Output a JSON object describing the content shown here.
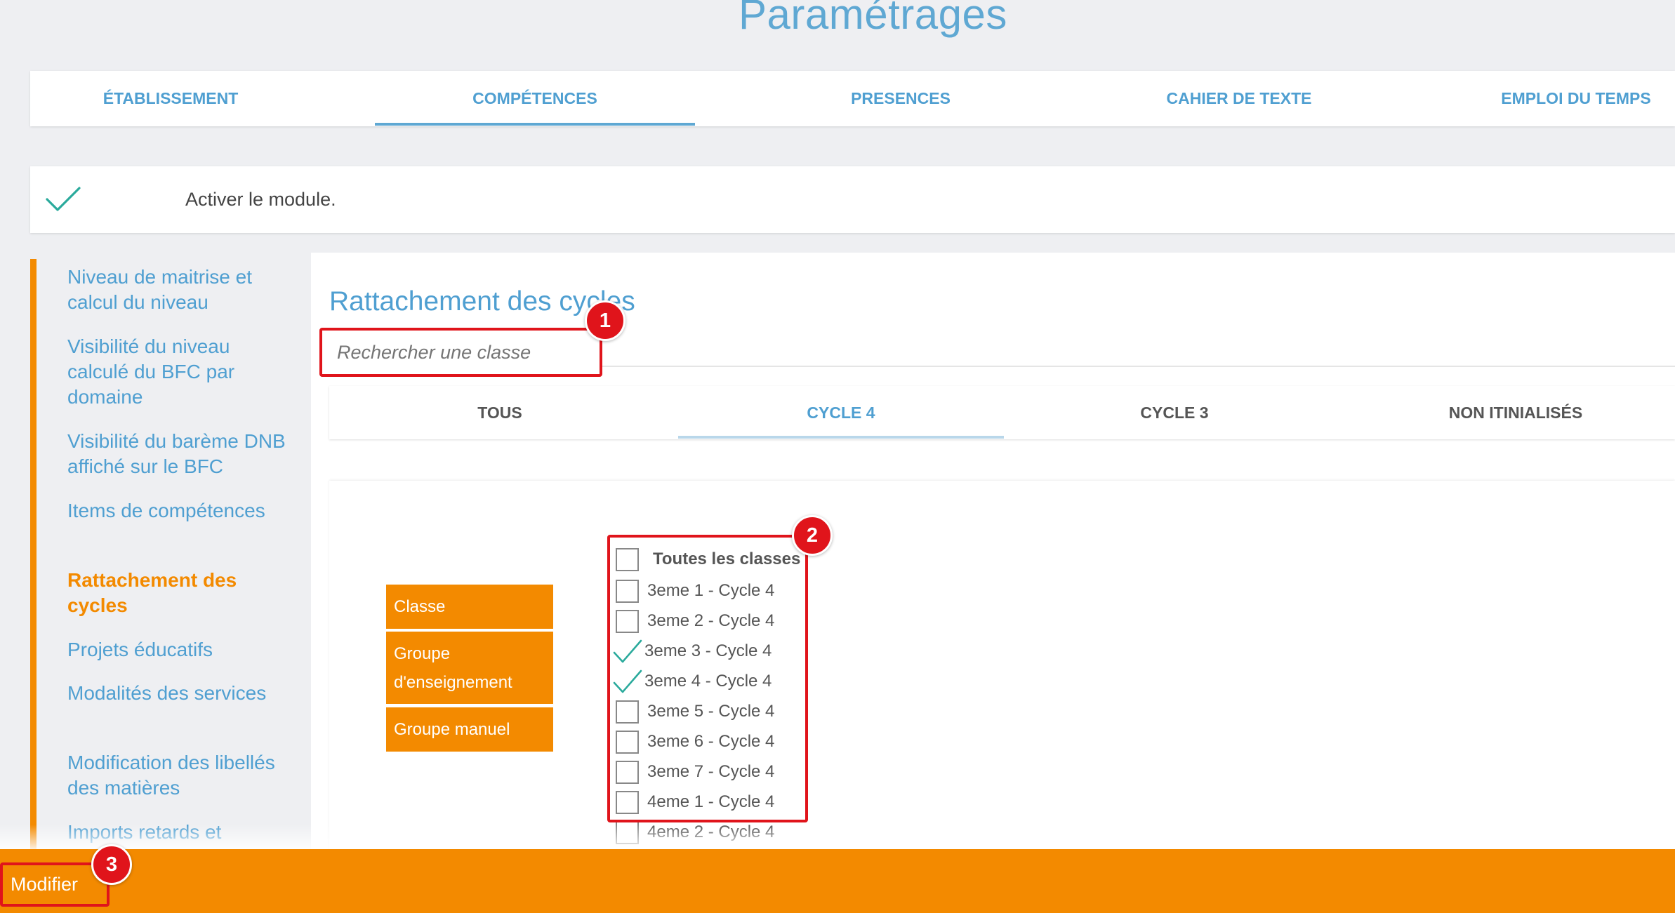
{
  "page": {
    "title": "Paramétrages"
  },
  "top_tabs": [
    {
      "label": "ÉTABLISSEMENT"
    },
    {
      "label": "COMPÉTENCES"
    },
    {
      "label": "PRESENCES"
    },
    {
      "label": "CAHIER DE TEXTE"
    },
    {
      "label": "EMPLOI DU TEMPS"
    }
  ],
  "active_top_tab": "COMPÉTENCES",
  "module": {
    "label": "Activer le module.",
    "enabled": true
  },
  "sidebar": {
    "items": [
      {
        "label": "Niveau de maitrise et calcul du niveau"
      },
      {
        "label": "Visibilité du niveau calculé du BFC par domaine"
      },
      {
        "label": "Visibilité du barème DNB affiché sur le BFC"
      },
      {
        "label": "Items de compétences"
      },
      {
        "label": "Rattachement des cycles"
      },
      {
        "label": "Projets éducatifs"
      },
      {
        "label": "Modalités des services"
      },
      {
        "label": "Modification des libellés des matières"
      },
      {
        "label": "Imports retards et"
      }
    ],
    "active_item": "Rattachement des cycles"
  },
  "main": {
    "section_title": "Rattachement des cycles",
    "search": {
      "placeholder": "Rechercher une classe",
      "value": ""
    },
    "cycle_tabs": [
      {
        "label": "TOUS"
      },
      {
        "label": "CYCLE 4"
      },
      {
        "label": "CYCLE 3"
      },
      {
        "label": "NON ITINIALISÉS"
      }
    ],
    "active_cycle_tab": "CYCLE 4",
    "group_buttons": [
      {
        "label": "Classe"
      },
      {
        "label": "Groupe d'enseignement"
      },
      {
        "label": "Groupe manuel"
      }
    ],
    "select_all": {
      "label": "Toutes les classes",
      "checked": false
    },
    "classes": [
      {
        "label": "3eme 1 - Cycle 4",
        "checked": false
      },
      {
        "label": "3eme 2 - Cycle 4",
        "checked": false
      },
      {
        "label": "3eme 3 - Cycle 4",
        "checked": true
      },
      {
        "label": "3eme 4 - Cycle 4",
        "checked": true
      },
      {
        "label": "3eme 5 - Cycle 4",
        "checked": false
      },
      {
        "label": "3eme 6 - Cycle 4",
        "checked": false
      },
      {
        "label": "3eme 7 - Cycle 4",
        "checked": false
      },
      {
        "label": "4eme 1 - Cycle 4",
        "checked": false
      },
      {
        "label": "4eme 2 - Cycle 4",
        "checked": false
      }
    ]
  },
  "footer": {
    "modify_label": "Modifier"
  },
  "callouts": [
    {
      "number": "1"
    },
    {
      "number": "2"
    },
    {
      "number": "3"
    }
  ],
  "colors": {
    "accent_orange": "#f38a00",
    "link_blue": "#4f9fd1",
    "title_blue": "#5fa8d3",
    "check_teal": "#2aaa9c",
    "highlight_red": "#e0141b"
  }
}
